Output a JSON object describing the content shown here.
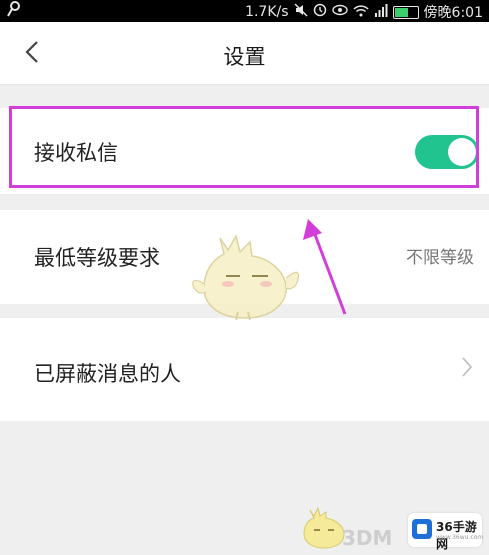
{
  "status_bar": {
    "speed": "1.7K/s",
    "time": "傍晚6:01",
    "icons": [
      "key-icon",
      "mute-icon",
      "alarm-icon",
      "eye-icon",
      "wifi-icon",
      "signal-icon",
      "battery-icon"
    ]
  },
  "header": {
    "title": "设置",
    "back_icon": "chevron-left-icon"
  },
  "settings": {
    "receive_messages": {
      "label": "接收私信",
      "enabled": true
    },
    "min_level": {
      "label": "最低等级要求",
      "value": "不限等级"
    },
    "blocked_users": {
      "label": "已屏蔽消息的人",
      "icon": "chevron-right-icon"
    }
  },
  "watermark": {
    "brand": "3DM",
    "badge_text": "36手游网",
    "badge_sub": "www.36wu.com"
  },
  "colors": {
    "toggle_on": "#21c38f",
    "highlight": "#d43ed8",
    "background": "#efefef"
  }
}
